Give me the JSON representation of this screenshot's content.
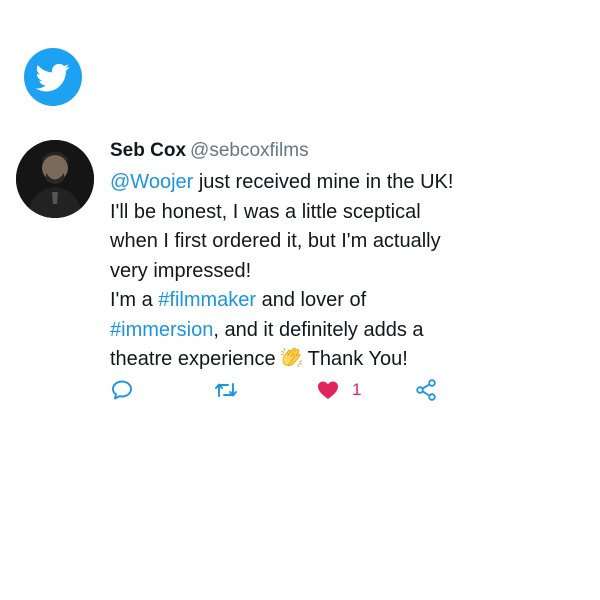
{
  "logo": {
    "icon": "twitter-bird-icon",
    "color": "#1da1f2"
  },
  "tweet": {
    "author_name": "Seb Cox",
    "author_handle": "@sebcoxfilms",
    "lines": {
      "l1_mention": "@Woojer",
      "l1_text": " just received mine in the UK!",
      "l2": "I'll be honest, I was a little sceptical",
      "l3": "when I first ordered it, but I'm actually",
      "l4": "very impressed!",
      "l5_prefix": "I'm a ",
      "l5_hashtag": "#filmmaker",
      "l5_suffix": " and lover of",
      "l6_hashtag": "#immersion",
      "l6_suffix": ", and it definitely adds a",
      "l7_prefix": "theatre experience",
      "l7_suffix": "Thank You!"
    },
    "emoji": "clapping-hands-emoji",
    "link_color": "#1b95e0"
  },
  "actions": {
    "reply_icon": "reply-icon",
    "retweet_icon": "retweet-icon",
    "like_icon": "heart-icon",
    "like_count": "1",
    "like_color": "#e0245e",
    "share_icon": "share-icon"
  }
}
